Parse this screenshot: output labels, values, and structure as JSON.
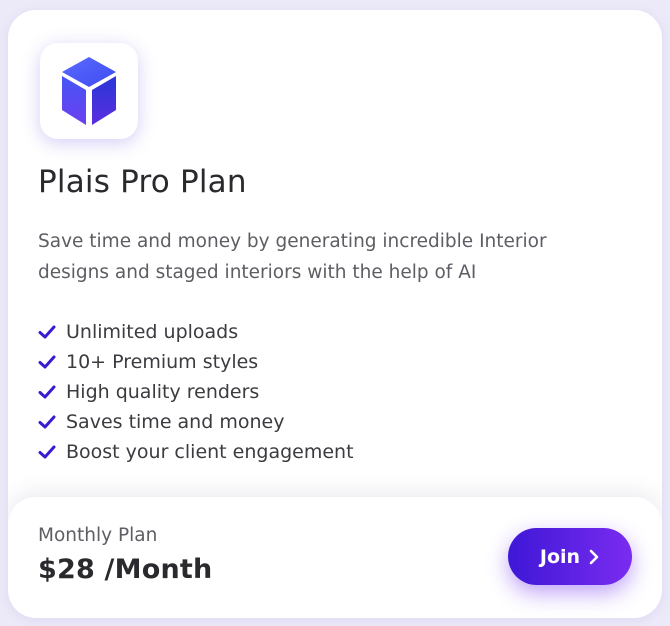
{
  "plan": {
    "title": "Plais Pro Plan",
    "description": "Save time and money by generating incredible Interior designs and staged interiors with the help of AI",
    "logo_icon": "cube-icon",
    "features": [
      "Unlimited uploads",
      "10+ Premium styles",
      "High quality renders",
      "Saves time and money",
      "Boost your client engagement"
    ]
  },
  "footer": {
    "plan_name": "Monthly Plan",
    "price": "$28 /Month",
    "join_label": "Join"
  },
  "colors": {
    "accent": "#4a1fe0",
    "button_gradient_start": "#3e17d6",
    "button_gradient_end": "#7a2cf0",
    "check": "#3a1bd0"
  },
  "icons": {
    "check": "check-icon",
    "join_arrow": "chevron-right-icon"
  }
}
